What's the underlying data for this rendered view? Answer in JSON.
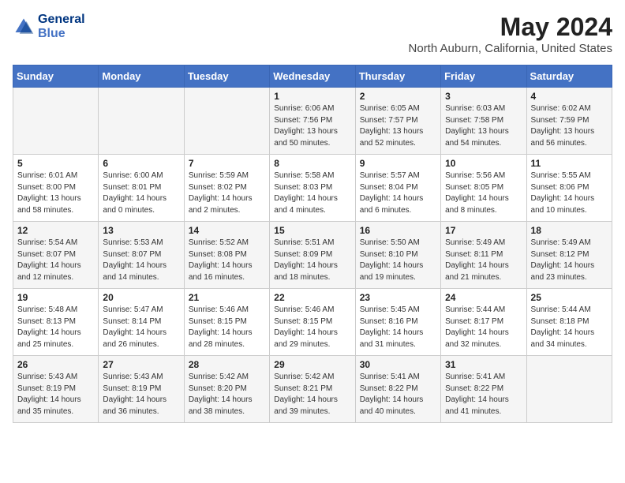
{
  "logo": {
    "line1": "General",
    "line2": "Blue"
  },
  "title": "May 2024",
  "subtitle": "North Auburn, California, United States",
  "days_of_week": [
    "Sunday",
    "Monday",
    "Tuesday",
    "Wednesday",
    "Thursday",
    "Friday",
    "Saturday"
  ],
  "weeks": [
    [
      {
        "day": "",
        "content": ""
      },
      {
        "day": "",
        "content": ""
      },
      {
        "day": "",
        "content": ""
      },
      {
        "day": "1",
        "content": "Sunrise: 6:06 AM\nSunset: 7:56 PM\nDaylight: 13 hours\nand 50 minutes."
      },
      {
        "day": "2",
        "content": "Sunrise: 6:05 AM\nSunset: 7:57 PM\nDaylight: 13 hours\nand 52 minutes."
      },
      {
        "day": "3",
        "content": "Sunrise: 6:03 AM\nSunset: 7:58 PM\nDaylight: 13 hours\nand 54 minutes."
      },
      {
        "day": "4",
        "content": "Sunrise: 6:02 AM\nSunset: 7:59 PM\nDaylight: 13 hours\nand 56 minutes."
      }
    ],
    [
      {
        "day": "5",
        "content": "Sunrise: 6:01 AM\nSunset: 8:00 PM\nDaylight: 13 hours\nand 58 minutes."
      },
      {
        "day": "6",
        "content": "Sunrise: 6:00 AM\nSunset: 8:01 PM\nDaylight: 14 hours\nand 0 minutes."
      },
      {
        "day": "7",
        "content": "Sunrise: 5:59 AM\nSunset: 8:02 PM\nDaylight: 14 hours\nand 2 minutes."
      },
      {
        "day": "8",
        "content": "Sunrise: 5:58 AM\nSunset: 8:03 PM\nDaylight: 14 hours\nand 4 minutes."
      },
      {
        "day": "9",
        "content": "Sunrise: 5:57 AM\nSunset: 8:04 PM\nDaylight: 14 hours\nand 6 minutes."
      },
      {
        "day": "10",
        "content": "Sunrise: 5:56 AM\nSunset: 8:05 PM\nDaylight: 14 hours\nand 8 minutes."
      },
      {
        "day": "11",
        "content": "Sunrise: 5:55 AM\nSunset: 8:06 PM\nDaylight: 14 hours\nand 10 minutes."
      }
    ],
    [
      {
        "day": "12",
        "content": "Sunrise: 5:54 AM\nSunset: 8:07 PM\nDaylight: 14 hours\nand 12 minutes."
      },
      {
        "day": "13",
        "content": "Sunrise: 5:53 AM\nSunset: 8:07 PM\nDaylight: 14 hours\nand 14 minutes."
      },
      {
        "day": "14",
        "content": "Sunrise: 5:52 AM\nSunset: 8:08 PM\nDaylight: 14 hours\nand 16 minutes."
      },
      {
        "day": "15",
        "content": "Sunrise: 5:51 AM\nSunset: 8:09 PM\nDaylight: 14 hours\nand 18 minutes."
      },
      {
        "day": "16",
        "content": "Sunrise: 5:50 AM\nSunset: 8:10 PM\nDaylight: 14 hours\nand 19 minutes."
      },
      {
        "day": "17",
        "content": "Sunrise: 5:49 AM\nSunset: 8:11 PM\nDaylight: 14 hours\nand 21 minutes."
      },
      {
        "day": "18",
        "content": "Sunrise: 5:49 AM\nSunset: 8:12 PM\nDaylight: 14 hours\nand 23 minutes."
      }
    ],
    [
      {
        "day": "19",
        "content": "Sunrise: 5:48 AM\nSunset: 8:13 PM\nDaylight: 14 hours\nand 25 minutes."
      },
      {
        "day": "20",
        "content": "Sunrise: 5:47 AM\nSunset: 8:14 PM\nDaylight: 14 hours\nand 26 minutes."
      },
      {
        "day": "21",
        "content": "Sunrise: 5:46 AM\nSunset: 8:15 PM\nDaylight: 14 hours\nand 28 minutes."
      },
      {
        "day": "22",
        "content": "Sunrise: 5:46 AM\nSunset: 8:15 PM\nDaylight: 14 hours\nand 29 minutes."
      },
      {
        "day": "23",
        "content": "Sunrise: 5:45 AM\nSunset: 8:16 PM\nDaylight: 14 hours\nand 31 minutes."
      },
      {
        "day": "24",
        "content": "Sunrise: 5:44 AM\nSunset: 8:17 PM\nDaylight: 14 hours\nand 32 minutes."
      },
      {
        "day": "25",
        "content": "Sunrise: 5:44 AM\nSunset: 8:18 PM\nDaylight: 14 hours\nand 34 minutes."
      }
    ],
    [
      {
        "day": "26",
        "content": "Sunrise: 5:43 AM\nSunset: 8:19 PM\nDaylight: 14 hours\nand 35 minutes."
      },
      {
        "day": "27",
        "content": "Sunrise: 5:43 AM\nSunset: 8:19 PM\nDaylight: 14 hours\nand 36 minutes."
      },
      {
        "day": "28",
        "content": "Sunrise: 5:42 AM\nSunset: 8:20 PM\nDaylight: 14 hours\nand 38 minutes."
      },
      {
        "day": "29",
        "content": "Sunrise: 5:42 AM\nSunset: 8:21 PM\nDaylight: 14 hours\nand 39 minutes."
      },
      {
        "day": "30",
        "content": "Sunrise: 5:41 AM\nSunset: 8:22 PM\nDaylight: 14 hours\nand 40 minutes."
      },
      {
        "day": "31",
        "content": "Sunrise: 5:41 AM\nSunset: 8:22 PM\nDaylight: 14 hours\nand 41 minutes."
      },
      {
        "day": "",
        "content": ""
      }
    ]
  ]
}
